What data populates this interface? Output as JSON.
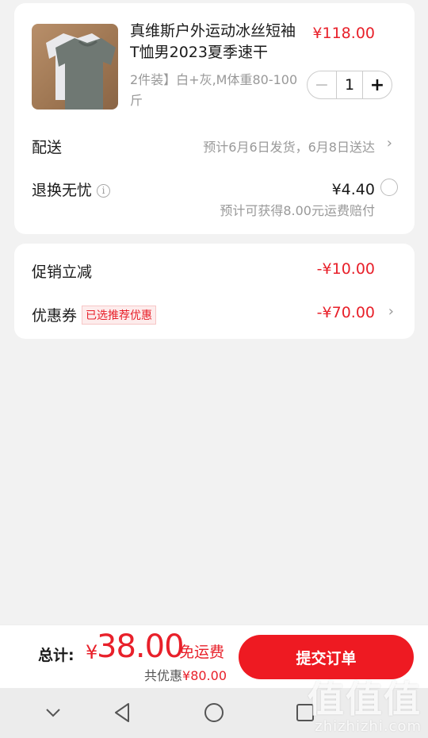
{
  "product": {
    "title": "真维斯户外运动冰丝短袖T恤男2023夏季速干",
    "price": "¥118.00",
    "spec": "2件装】白+灰,M体重80-100斤",
    "quantity": "1",
    "minus_symbol": "−",
    "plus_symbol": "+"
  },
  "delivery": {
    "label": "配送",
    "info": "预计6月6日发货，6月8日送达",
    "chevron": "›"
  },
  "return_service": {
    "label": "退换无忧",
    "info_symbol": "i",
    "price": "¥4.40",
    "note": "预计可获得8.00元运费赔付"
  },
  "promo": {
    "label": "促销立减",
    "amount": "-¥10.00"
  },
  "coupon": {
    "label": "优惠券",
    "tag": "已选推荐优惠",
    "amount": "-¥70.00",
    "chevron": "›"
  },
  "checkout": {
    "total_label": "总计:",
    "currency": "¥",
    "total_amount": "38.00",
    "free_shipping": "免运费",
    "discount_prefix": "共优惠",
    "discount_amount": "¥80.00",
    "submit_label": "提交订单"
  },
  "watermark": {
    "big": "值值值",
    "small": "zhizhizhi.com"
  },
  "colors": {
    "accent_red": "#e8202a",
    "button_red": "#ee1a22"
  },
  "icons": [
    "info-icon",
    "chevron-right-icon",
    "radio-icon",
    "nav-back-icon",
    "nav-home-icon",
    "nav-recents-icon",
    "nav-hide-icon"
  ]
}
